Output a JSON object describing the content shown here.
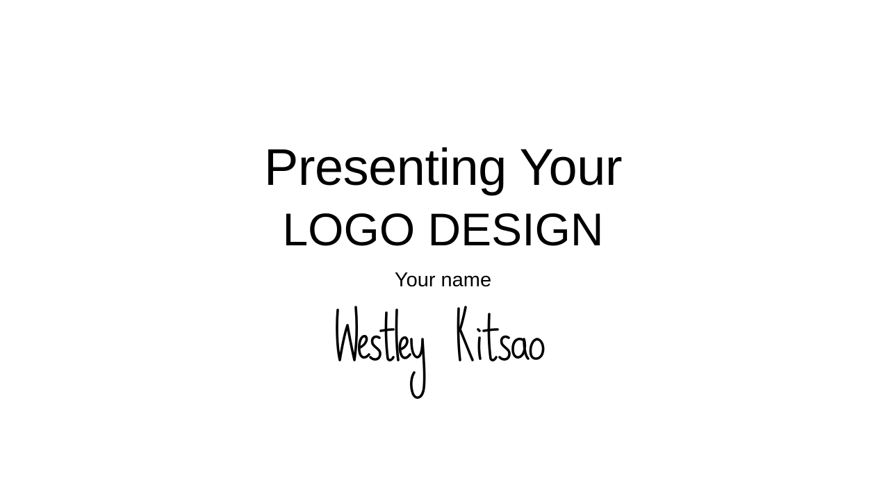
{
  "slide": {
    "title_line_1": "Presenting Your",
    "title_line_2": "LOGO DESIGN",
    "subtitle": "Your name",
    "signature_text": "Wesley Kitsao"
  },
  "colors": {
    "background": "#ffffff",
    "text": "#000000"
  }
}
